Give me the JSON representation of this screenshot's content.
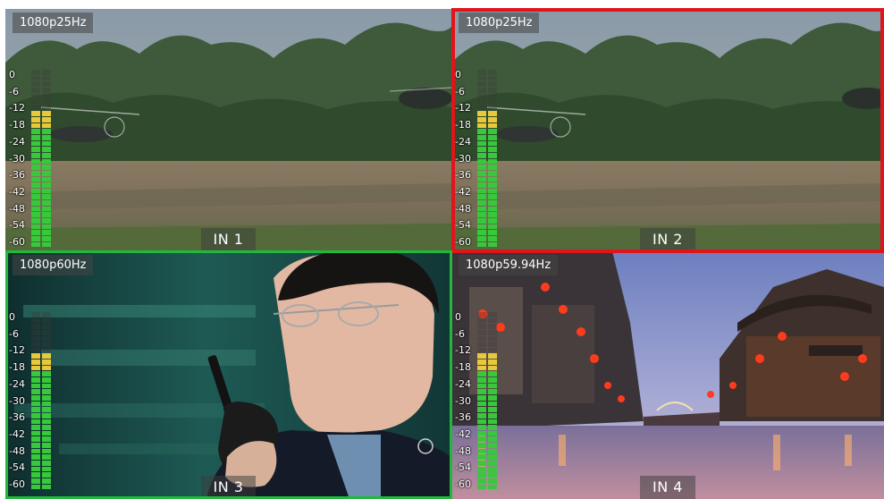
{
  "multiviewer": {
    "tiles": [
      {
        "id": "in1",
        "input_label": "IN 1",
        "format": "1080p25Hz",
        "tally": "none",
        "scene": "jungle-helicopter"
      },
      {
        "id": "in2",
        "input_label": "IN 2",
        "format": "1080p25Hz",
        "tally": "program",
        "scene": "jungle-helicopter"
      },
      {
        "id": "in3",
        "input_label": "IN 3",
        "format": "1080p60Hz",
        "tally": "preview",
        "scene": "officer-radio"
      },
      {
        "id": "in4",
        "input_label": "IN 4",
        "format": "1080p59.94Hz",
        "tally": "none",
        "scene": "lantern-street"
      }
    ],
    "audio_meter_scale": [
      "0",
      "-6",
      "-12",
      "-18",
      "-24",
      "-30",
      "-36",
      "-42",
      "-48",
      "-54",
      "-60"
    ],
    "audio_level_dbfs": -14
  },
  "colors": {
    "tally_program": "#e2141b",
    "tally_preview": "#20b93c",
    "meter_green": "#37c93b",
    "meter_yellow": "#e8c93a"
  },
  "icons": []
}
